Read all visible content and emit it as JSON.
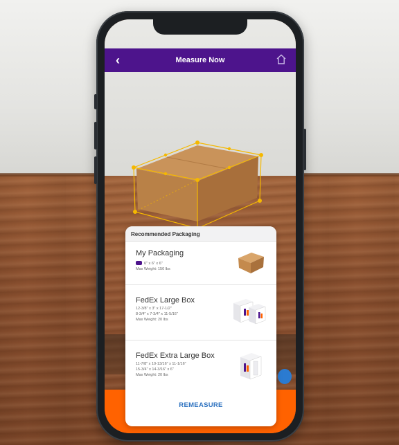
{
  "app": {
    "title": "Measure Now"
  },
  "sheet": {
    "header": "Recommended Packaging",
    "items": [
      {
        "name": "My Packaging",
        "lines": [
          "6\" x 6\" x 6\"",
          "Max Weight: 150 lbs"
        ],
        "icon": "cardboard-box-icon"
      },
      {
        "name": "FedEx Large Box",
        "lines": [
          "12-3/8\" x 3\" x 17-1/2\"",
          "8-3/4\" x 7-3/4\" x 11-5/16\"",
          "Max Weight: 20 lbs"
        ],
        "icon": "fedex-large-box-icon"
      },
      {
        "name": "FedEx Extra Large Box",
        "lines": [
          "11-7/8\" x 10-13/16\" x 11-1/16\"",
          "15-3/4\" x 14-3/16\" x 6\"",
          "Max Weight: 20 lbs"
        ],
        "icon": "fedex-extra-large-box-icon"
      }
    ],
    "action_label": "REMEASURE"
  },
  "colors": {
    "brand_purple": "#4d148c",
    "brand_orange": "#ff6200",
    "link_blue": "#2f73c0",
    "measure_outline": "#f5b800"
  }
}
